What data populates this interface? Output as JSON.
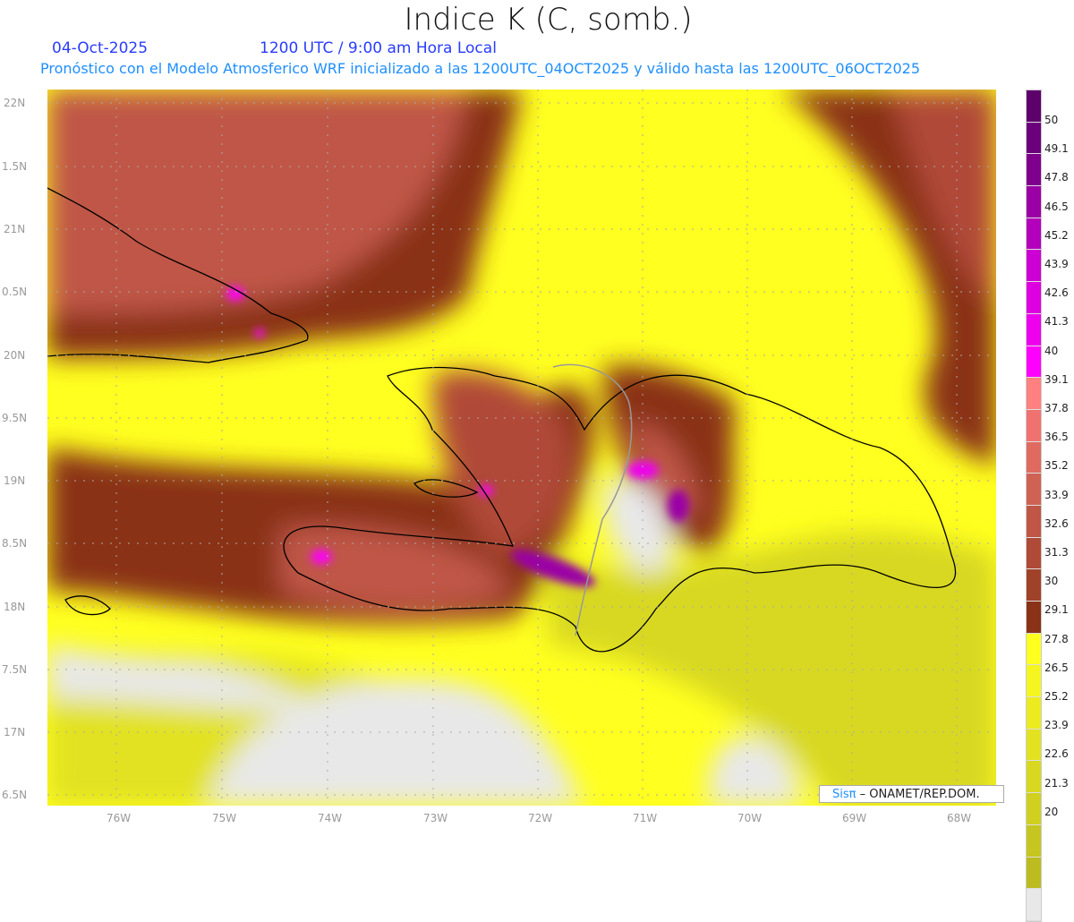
{
  "header": {
    "title": "Indice K (C, somb.)",
    "date": "04-Oct-2025",
    "time": "1200 UTC / 9:00 am Hora Local",
    "description": "Pronóstico con el Modelo Atmosferico WRF inicializado a las 1200UTC_04OCT2025 y válido hasta las  1200UTC_06OCT2025"
  },
  "axes": {
    "lon_labels": [
      "76W",
      "75W",
      "74W",
      "73W",
      "72W",
      "71W",
      "70W",
      "69W",
      "68W"
    ],
    "lat_labels": [
      "22N",
      "1.5N",
      "21N",
      "0.5N",
      "20N",
      "9.5N",
      "19N",
      "8.5N",
      "18N",
      "7.5N",
      "17N",
      "6.5N"
    ]
  },
  "colorbar": {
    "labels": [
      "50",
      "49.1",
      "47.8",
      "46.5",
      "45.2",
      "43.9",
      "42.6",
      "41.3",
      "40",
      "39.1",
      "37.8",
      "36.5",
      "35.2",
      "33.9",
      "32.6",
      "31.3",
      "30",
      "29.1",
      "27.8",
      "26.5",
      "25.2",
      "23.9",
      "22.6",
      "21.3",
      "20"
    ],
    "colors": [
      "#5e006c",
      "#6c007c",
      "#80008e",
      "#9a00a6",
      "#b400bc",
      "#cc00d4",
      "#de00e0",
      "#ee00ee",
      "#ff00ff",
      "#ff8080",
      "#ef7270",
      "#e06a60",
      "#d06254",
      "#c05646",
      "#b04a38",
      "#a0422a",
      "#8a3218",
      "#ffff20",
      "#f5f520",
      "#ebeb20",
      "#e2e220",
      "#d8d820",
      "#d0d020",
      "#c6c620",
      "#bcbc20",
      "#e8e8e8"
    ]
  },
  "credit": {
    "brand": "Sisπ",
    "text": " –  ONAMET/REP.DOM."
  }
}
